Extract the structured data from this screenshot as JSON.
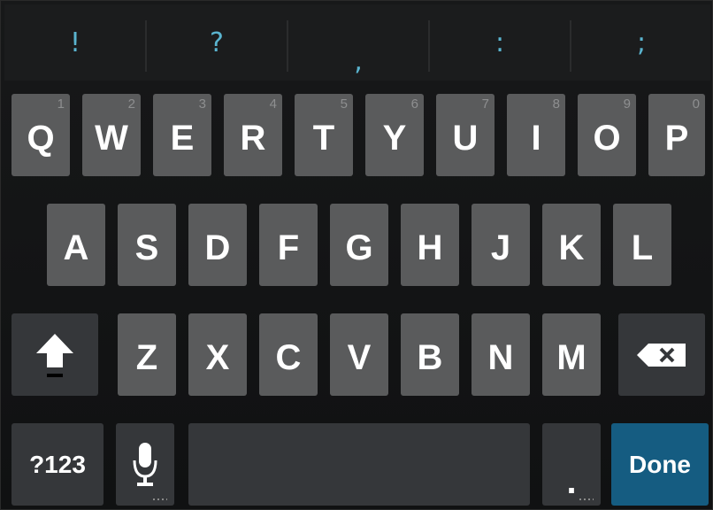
{
  "suggestions": [
    "!",
    "?",
    ",",
    ":",
    ";"
  ],
  "rows": {
    "row1": [
      {
        "label": "Q",
        "hint": "1"
      },
      {
        "label": "W",
        "hint": "2"
      },
      {
        "label": "E",
        "hint": "3"
      },
      {
        "label": "R",
        "hint": "4"
      },
      {
        "label": "T",
        "hint": "5"
      },
      {
        "label": "Y",
        "hint": "6"
      },
      {
        "label": "U",
        "hint": "7"
      },
      {
        "label": "I",
        "hint": "8"
      },
      {
        "label": "O",
        "hint": "9"
      },
      {
        "label": "P",
        "hint": "0"
      }
    ],
    "row2": [
      "A",
      "S",
      "D",
      "F",
      "G",
      "H",
      "J",
      "K",
      "L"
    ],
    "row3": [
      "Z",
      "X",
      "C",
      "V",
      "B",
      "N",
      "M"
    ]
  },
  "bottom": {
    "symbols_label": "?123",
    "period_label": ".",
    "done_label": "Done"
  },
  "colors": {
    "key": "#5a5b5c",
    "key_dark": "#35373a",
    "accent": "#155c81",
    "suggestion": "#5ab4cf"
  },
  "icons": {
    "shift": "shift-arrow-icon",
    "backspace": "backspace-icon",
    "mic": "microphone-icon"
  }
}
